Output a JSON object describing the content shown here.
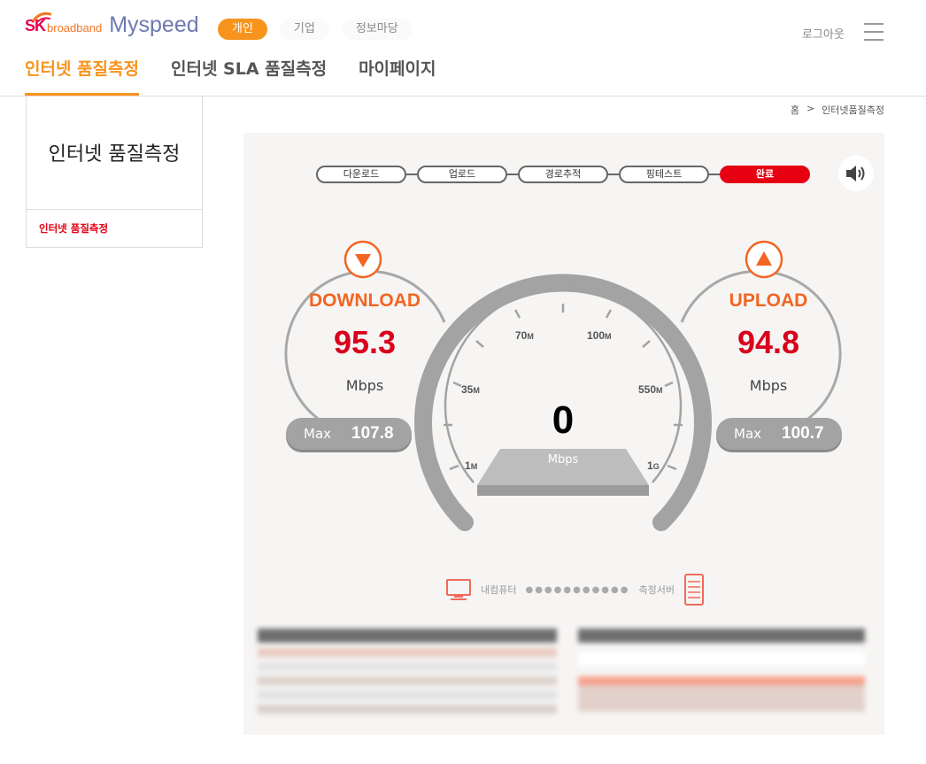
{
  "header": {
    "logo_sk": "SK",
    "logo_broadband": "broadband",
    "logo_myspeed": "Myspeed",
    "top_tabs": [
      "개인",
      "기업",
      "정보마당"
    ],
    "logout": "로그아웃"
  },
  "nav": {
    "items": [
      "인터넷 품질측정",
      "인터넷 SLA 품질측정",
      "마이페이지"
    ]
  },
  "sidebar": {
    "title": "인터넷 품질측정",
    "items": [
      "인터넷 품질측정"
    ]
  },
  "breadcrumb": [
    "홈",
    ">",
    "인터넷품질측정"
  ],
  "steps": [
    "다운로드",
    "업로드",
    "경로추적",
    "핑테스트",
    "완료"
  ],
  "download": {
    "label": "DOWNLOAD",
    "value": "95.3",
    "unit": "Mbps",
    "max_label": "Max",
    "max_value": "107.8"
  },
  "upload": {
    "label": "UPLOAD",
    "value": "94.8",
    "unit": "Mbps",
    "max_label": "Max",
    "max_value": "100.7"
  },
  "speedometer": {
    "current": "0",
    "unit": "Mbps",
    "ticks": [
      {
        "num": "1",
        "suffix": "M"
      },
      {
        "num": "35",
        "suffix": "M"
      },
      {
        "num": "70",
        "suffix": "M"
      },
      {
        "num": "100",
        "suffix": "M"
      },
      {
        "num": "550",
        "suffix": "M"
      },
      {
        "num": "1",
        "suffix": "G"
      }
    ]
  },
  "route": {
    "from": "내컴퓨터",
    "dots": "●●●●●●●●●●●",
    "to": "측정서버"
  },
  "colors": {
    "accent_orange": "#f7941d",
    "brand_red": "#e60012",
    "value_red": "#d9001b",
    "gauge_gray": "#a3a3a3"
  }
}
